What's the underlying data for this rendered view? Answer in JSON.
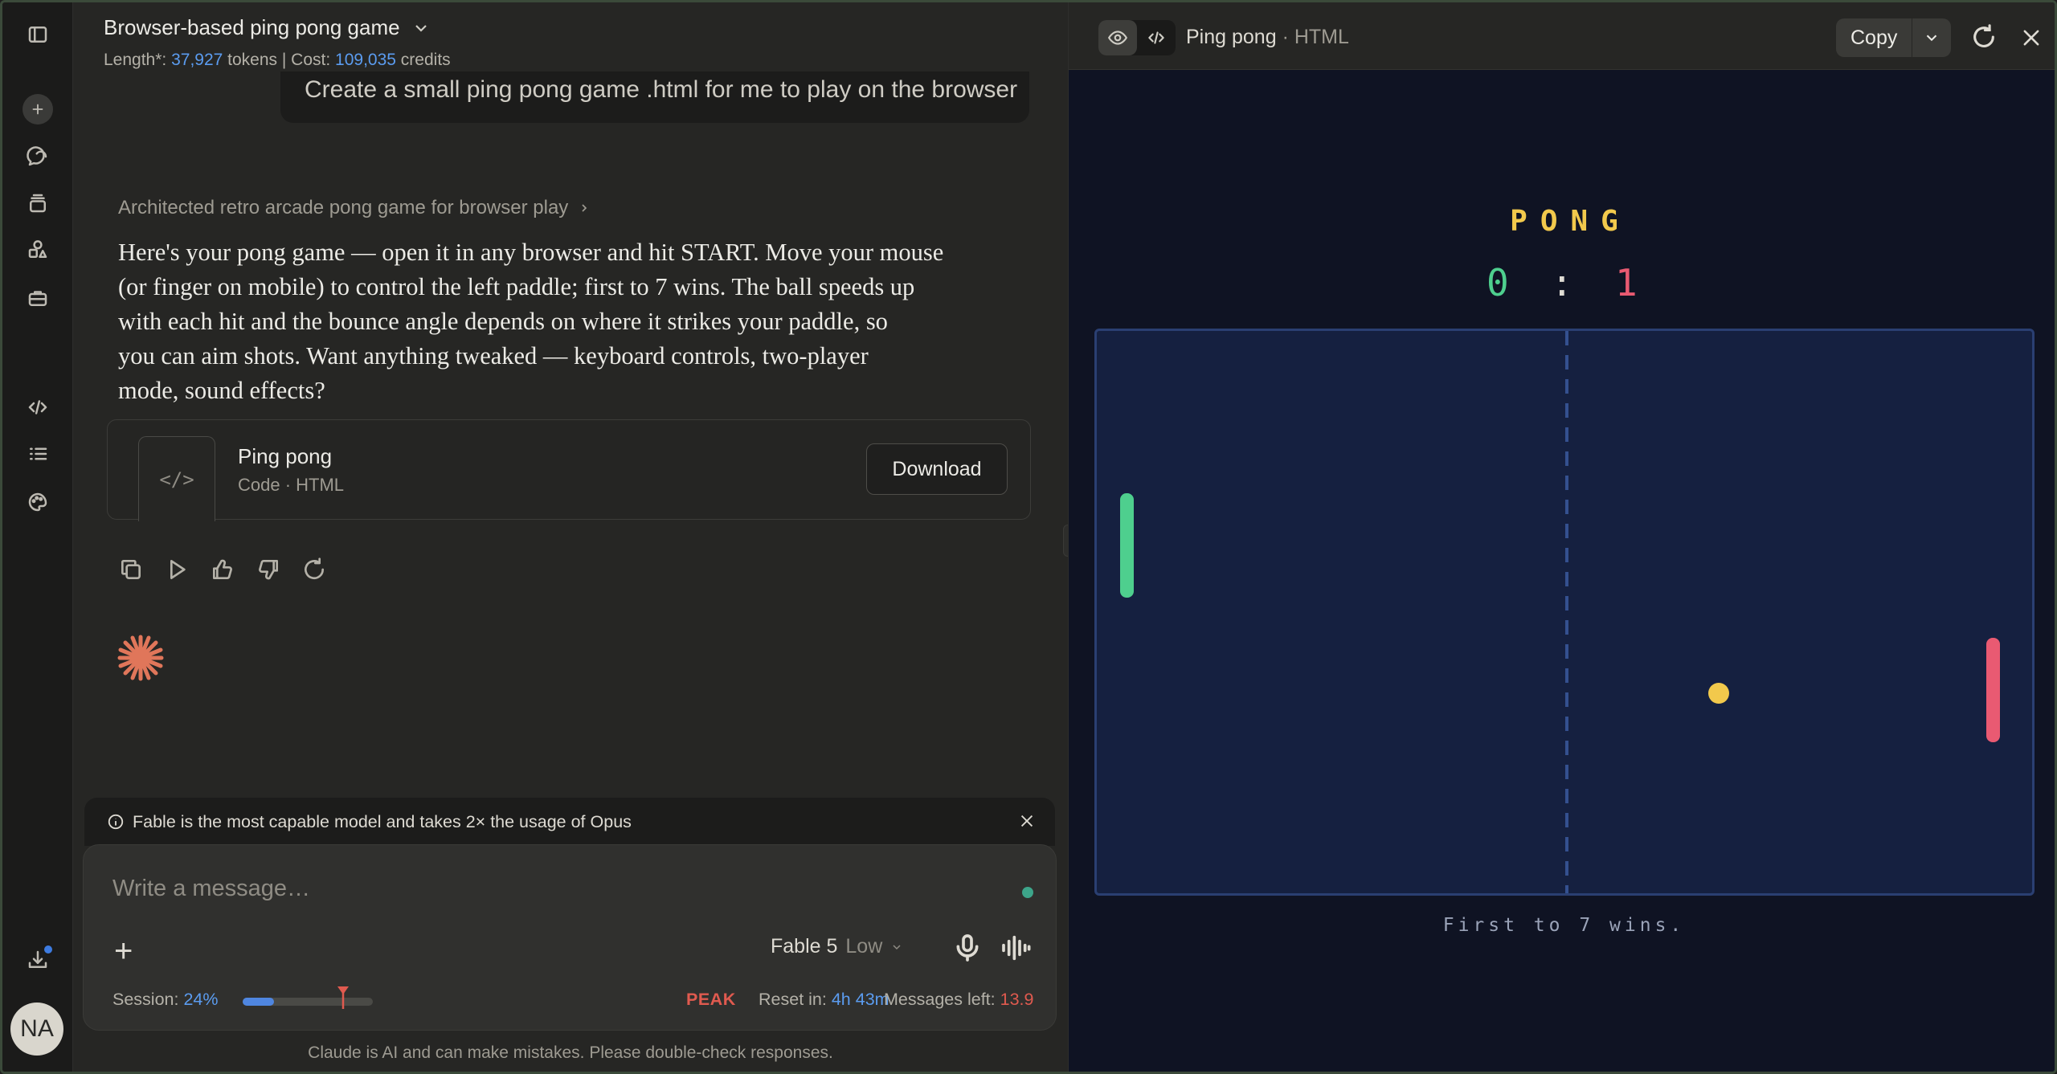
{
  "chat": {
    "title": "Browser-based ping pong game",
    "meta": {
      "length_label": "Length*:",
      "tokens": "37,927",
      "tokens_suffix": "tokens | Cost:",
      "credits": "109,035",
      "credits_suffix": "credits"
    },
    "user_message": "Create a small ping pong game .html for me to play on the browser",
    "thinking_summary": "Architected retro arcade pong game for browser play",
    "reply_lines": [
      "Here's your pong game — open it in any browser and hit START. Move your mouse",
      "(or finger on mobile) to control the left paddle; first to 7 wins. The ball speeds up",
      "with each hit and the bounce angle depends on where it strikes your paddle, so",
      "you can aim shots. Want anything tweaked — keyboard controls, two-player",
      "mode, sound effects?"
    ],
    "artifact": {
      "name": "Ping pong",
      "type": "Code · HTML",
      "thumb_glyph": "</>",
      "download_label": "Download"
    }
  },
  "notice": {
    "text": "Fable is the most capable model and takes 2× the usage of Opus"
  },
  "composer": {
    "placeholder": "Write a message…",
    "model": "Fable 5",
    "effort": "Low",
    "session_label": "Session:",
    "session_percent": "24%",
    "session_fraction": 0.24,
    "peak_label": "PEAK",
    "reset_label": "Reset in:",
    "reset_value": "4h 43m",
    "messages_label": "Messages left:",
    "messages_value": "13.9"
  },
  "disclaimer": "Claude is AI and can make mistakes. Please double-check responses.",
  "user": {
    "initials": "NA"
  },
  "panel": {
    "title": "Ping pong",
    "subtitle": "· HTML",
    "copy_label": "Copy"
  },
  "game": {
    "title": "PONG",
    "score_left": "0",
    "score_separator": ":",
    "score_right": "1",
    "footer": "First to 7 wins."
  },
  "colors": {
    "accent_blue": "#5b9cf0",
    "peak_red": "#e05a4f",
    "paddle_left": "#4ecf8e",
    "paddle_right": "#e95a72",
    "ball": "#f2c94c",
    "court": "#152040"
  },
  "icons": {
    "rail": [
      "sidebar-toggle-icon",
      "new-chat-icon",
      "chats-icon",
      "projects-icon",
      "artifacts-icon",
      "briefcase-icon",
      "code-icon",
      "tasks-icon",
      "palette-icon",
      "download-icon"
    ]
  }
}
